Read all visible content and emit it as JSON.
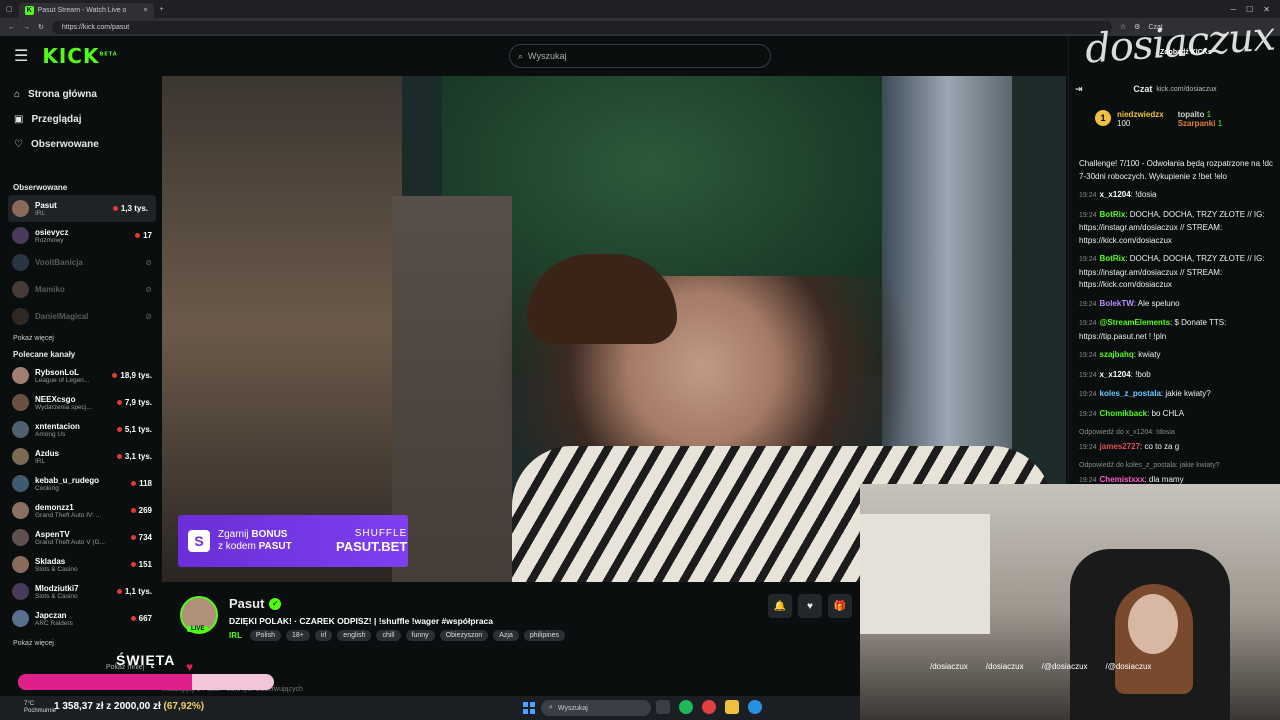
{
  "browser": {
    "tab_title": "Pasut Stream - Watch Live o",
    "url": "https://kick.com/pasut",
    "profile_label": "Czat"
  },
  "header": {
    "logo": "KICK",
    "logo_badge": "BETA",
    "search_placeholder": "Wyszukaj"
  },
  "sidebar": {
    "nav": [
      {
        "label": "Strona główna",
        "icon": "home-icon"
      },
      {
        "label": "Przeglądaj",
        "icon": "browse-icon"
      },
      {
        "label": "Obserwowane",
        "icon": "heart-icon"
      }
    ],
    "followed_title": "Obserwowane",
    "followed": [
      {
        "name": "Pasut",
        "category": "IRL",
        "viewers": "1,3 tys.",
        "live": true
      },
      {
        "name": "osievycz",
        "category": "Rozmowy",
        "viewers": "17",
        "live": true
      },
      {
        "name": "VooltBanicja",
        "category": "",
        "viewers": "",
        "live": false
      },
      {
        "name": "Mamiko",
        "category": "",
        "viewers": "",
        "live": false
      },
      {
        "name": "DanielMagical",
        "category": "",
        "viewers": "",
        "live": false
      }
    ],
    "show_more": "Pokaż więcej",
    "recommended_title": "Polecane kanały",
    "recommended": [
      {
        "name": "RybsonLoL",
        "category": "League of Legen...",
        "viewers": "18,9 tys."
      },
      {
        "name": "NEEXcsgo",
        "category": "Wydarzenia specj...",
        "viewers": "7,9 tys."
      },
      {
        "name": "xntentacion",
        "category": "Among Us",
        "viewers": "5,1 tys."
      },
      {
        "name": "Azdus",
        "category": "IRL",
        "viewers": "3,1 tys."
      },
      {
        "name": "kebab_u_rudego",
        "category": "Cooking",
        "viewers": "118"
      },
      {
        "name": "demonzz1",
        "category": "Grand Theft Auto IV: ...",
        "viewers": "269"
      },
      {
        "name": "AspenTV",
        "category": "Grand Theft Auto V (G...",
        "viewers": "734"
      },
      {
        "name": "Skladas",
        "category": "Slots & Casino",
        "viewers": "151"
      },
      {
        "name": "Mlodziutki7",
        "category": "Slots & Casino",
        "viewers": "1,1 tys."
      },
      {
        "name": "Japczan",
        "category": "ARC Raiders",
        "viewers": "667"
      }
    ],
    "show_more2": "Pokaż więcej",
    "show_less": "Pokaż mniej"
  },
  "promo": {
    "line1": "Zgarnij",
    "bonus": "BONUS",
    "line2": "z kodem",
    "code": "PASUT",
    "brand": "SHUFFLE",
    "site": "PASUT.BET"
  },
  "stream": {
    "streamer": "Pasut",
    "live_badge": "LIVE",
    "title": "DZIĘKI POLAK! · CZAREK ODPISZ! | !shuffle !wager #współpraca",
    "category": "IRL",
    "tags": [
      "Polish",
      "18+",
      "irl",
      "english",
      "chill",
      "funny",
      "Obieżyszon",
      "Azja",
      "philipines"
    ],
    "below_text": "Instalujący z Pasut · 53,6 tys. Obserwujących"
  },
  "chat": {
    "watermark": "dosiaczux",
    "header": "Czat",
    "header_sub": "kick.com/dosiaczux",
    "top_label": "Zdobądź KICKs",
    "leaderboard": [
      {
        "name": "niedzwiedzx",
        "amount": "100",
        "color": "#f0c040"
      },
      {
        "name": "topalto",
        "amount": "1",
        "color": "#cfcfcf"
      },
      {
        "name": "Szarpanki",
        "amount": "1",
        "color": "#e08040"
      }
    ],
    "pinned": "Challenge! 7/100 - Odwołania będą rozpatrzone na !dc 7-30dni roboczych. Wykupienie z !bet !elo",
    "messages": [
      {
        "time": "19:24",
        "user": "x_x1204",
        "color": "#ffffff",
        "text": "!dosia",
        "reply": ""
      },
      {
        "time": "19:24",
        "user": "BotRix",
        "color": "#53fc18",
        "text": "DOCHA, DOCHA, TRZY ZŁOTE // IG: https://instagr.am/dosiaczux // STREAM: https://kick.com/dosiaczux",
        "reply": ""
      },
      {
        "time": "19:24",
        "user": "BotRix",
        "color": "#53fc18",
        "text": "DOCHA, DOCHA, TRZY ZŁOTE // IG: https://instagr.am/dosiaczux // STREAM: https://kick.com/dosiaczux",
        "reply": ""
      },
      {
        "time": "19:24",
        "user": "BolekTW",
        "color": "#b98cff",
        "text": "Ale speluno",
        "reply": ""
      },
      {
        "time": "19:24",
        "user": "@StreamElements",
        "color": "#53fc18",
        "text": "$ Donate TTS: https://tip.pasut.net ! !pln",
        "reply": ""
      },
      {
        "time": "19:24",
        "user": "szajbahq",
        "color": "#53fc18",
        "text": "kwiaty",
        "reply": ""
      },
      {
        "time": "19:24",
        "user": "x_x1204",
        "color": "#ffffff",
        "text": "!bob",
        "reply": ""
      },
      {
        "time": "19:24",
        "user": "koles_z_postala",
        "color": "#6ac8ff",
        "text": "jakie kwiaty?",
        "reply": ""
      },
      {
        "time": "19:24",
        "user": "Chomikback",
        "color": "#53fc18",
        "text": "bo CHLA",
        "reply": ""
      },
      {
        "time": "19:24",
        "user": "james2727",
        "color": "#e05050",
        "text": "co to za g",
        "reply": "Odpowiedź do x_x1204: !dosia"
      },
      {
        "time": "19:24",
        "user": "Chemistxxx",
        "color": "#ff5ec7",
        "text": "dla mamy",
        "reply": "Odpowiedź do koles_z_postala: jakie kwiaty?"
      }
    ]
  },
  "webcam": {
    "socials": [
      "/dosiaczux",
      "/dosiaczux",
      "/@dosiaczux",
      "/@dosiaczux"
    ]
  },
  "overlay": {
    "event": "ŚWIĘTA",
    "progress_text": "1 358,37 zł z 2000,00 zł",
    "progress_pct": "(67,92%)",
    "progress_fraction": 0.679
  },
  "taskbar": {
    "weather": "7°C",
    "weather_desc": "Pochmurnie",
    "search": "Wyszukaj"
  }
}
